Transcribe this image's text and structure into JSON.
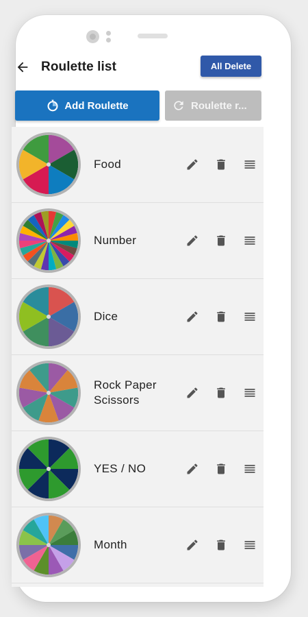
{
  "header": {
    "title": "Roulette list",
    "all_delete_label": "All Delete"
  },
  "buttons": {
    "add_label": "Add Roulette",
    "reset_label": "Roulette r..."
  },
  "colors": {
    "primary": "#1a73bf",
    "accent": "#3059a9",
    "disabled": "#bdbdbd",
    "list_bg": "#f2f2f2"
  },
  "icons": {
    "back": "arrow-left-icon",
    "add": "roulette-add-icon",
    "reset": "refresh-icon",
    "edit": "pencil-icon",
    "delete": "trash-icon",
    "drag": "drag-handle-icon"
  },
  "roulettes": [
    {
      "name": "Food",
      "colors": [
        "#a44b9a",
        "#1b5e33",
        "#0e7dbf",
        "#d61a52",
        "#f2b42a",
        "#3f9b3f"
      ]
    },
    {
      "name": "Number",
      "colors": [
        "#e53935",
        "#43a047",
        "#1e88e5",
        "#fdd835",
        "#8e24aa",
        "#fb8c00",
        "#00897b",
        "#6d4c41",
        "#d81b60",
        "#3949ab",
        "#7cb342",
        "#00acc1",
        "#5e35b1",
        "#c0ca33",
        "#546e7a",
        "#f4511e",
        "#26a69a",
        "#ec407a",
        "#ab47bc",
        "#ffb300",
        "#2e7d32",
        "#1565c0",
        "#ad1457",
        "#9e9d24"
      ]
    },
    {
      "name": "Dice",
      "colors": [
        "#d9534f",
        "#3a6ea5",
        "#6b5b95",
        "#3f8f5e",
        "#8fbf21",
        "#2a8c9b"
      ]
    },
    {
      "name": "Rock Paper Scissors",
      "colors": [
        "#9b5aa4",
        "#d9843b",
        "#3e9b8b",
        "#9b5aa4",
        "#d9843b",
        "#3e9b8b",
        "#9b5aa4",
        "#d9843b",
        "#3e9b8b"
      ]
    },
    {
      "name": "YES / NO",
      "colors": [
        "#0c2a5b",
        "#2e9a2e",
        "#0c2a5b",
        "#2e9a2e",
        "#0c2a5b",
        "#2e9a2e",
        "#0c2a5b",
        "#2e9a2e"
      ]
    },
    {
      "name": "Month",
      "colors": [
        "#d1894f",
        "#5a9c5a",
        "#3b7d3b",
        "#3f6ea8",
        "#c5a0e8",
        "#9b59b6",
        "#5c8f2a",
        "#f06292",
        "#7b6fa8",
        "#8bc34a",
        "#26a69a",
        "#4fc3f7"
      ]
    }
  ]
}
